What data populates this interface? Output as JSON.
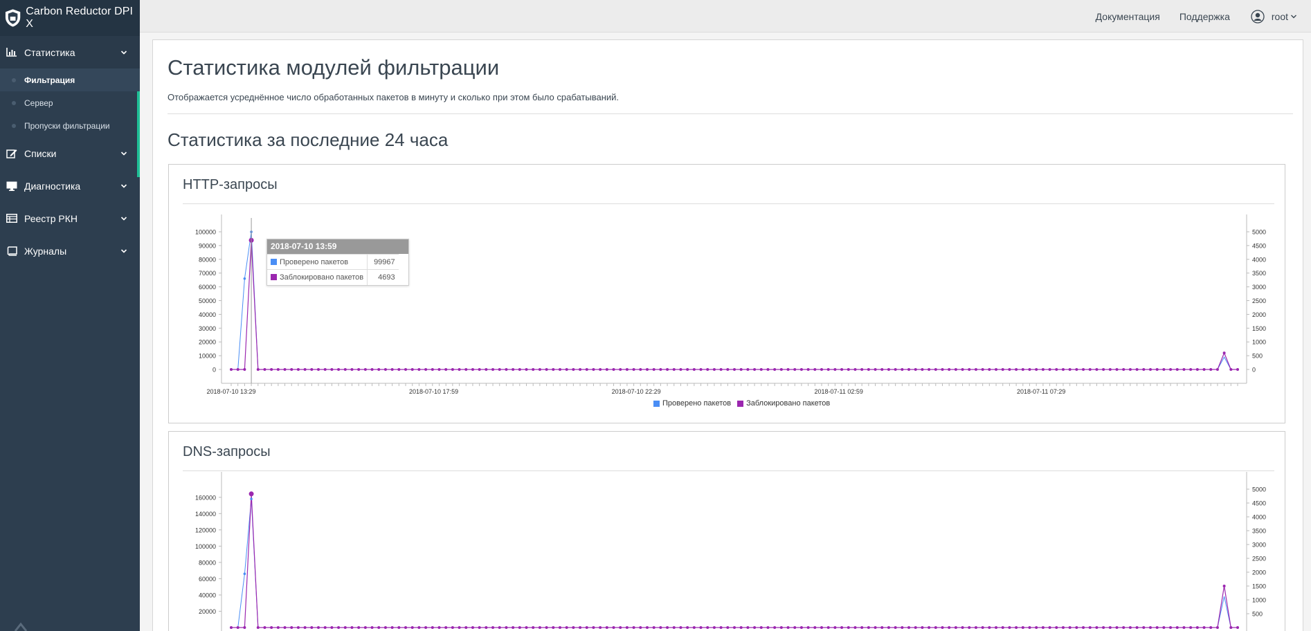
{
  "brand": {
    "title": "Carbon Reductor DPI X"
  },
  "sidebar": {
    "items": [
      {
        "label": "Статистика",
        "icon": "bar-chart-icon"
      },
      {
        "label": "Списки",
        "icon": "edit-icon"
      },
      {
        "label": "Диагностика",
        "icon": "monitor-icon"
      },
      {
        "label": "Реестр РКН",
        "icon": "table-icon"
      },
      {
        "label": "Журналы",
        "icon": "book-icon"
      }
    ],
    "subitems": [
      {
        "label": "Фильтрация",
        "active": true
      },
      {
        "label": "Сервер"
      },
      {
        "label": "Пропуски фильтрации"
      }
    ]
  },
  "topbar": {
    "docs": "Документация",
    "support": "Поддержка",
    "user": "root"
  },
  "page": {
    "title": "Статистика модулей фильтрации",
    "description": "Отображается усреднённое число обработанных пакетов в минуту и сколько при этом было срабатываний.",
    "section": "Статистика за последние 24 часа"
  },
  "colors": {
    "checked": "#4a8ef5",
    "blocked": "#9b27af",
    "accent": "#1fbf96",
    "sidebar": "#2d3e4f"
  },
  "http_panel": {
    "title": "HTTP-запросы",
    "tooltip": {
      "time": "2018-07-10 13:59",
      "rows": [
        {
          "label": "Проверено пакетов",
          "value": "99967"
        },
        {
          "label": "Заблокировано пакетов",
          "value": "4693"
        }
      ]
    },
    "legend": [
      "Проверено пакетов",
      "Заблокировано пакетов"
    ]
  },
  "dns_panel": {
    "title": "DNS-запросы"
  },
  "chart_data": [
    {
      "type": "line",
      "title": "HTTP-запросы",
      "x_ticks": [
        "2018-07-10 13:29",
        "2018-07-10 17:59",
        "2018-07-10 22:29",
        "2018-07-11 02:59",
        "2018-07-11 07:29"
      ],
      "y_left_ticks": [
        0,
        10000,
        20000,
        30000,
        40000,
        50000,
        60000,
        70000,
        80000,
        90000,
        100000
      ],
      "y_right_ticks": [
        0,
        500,
        1000,
        1500,
        2000,
        2500,
        3000,
        3500,
        4000,
        4500,
        5000
      ],
      "ylim_left": [
        0,
        100000
      ],
      "ylim_right": [
        0,
        5000
      ],
      "series": [
        {
          "name": "Проверено пакетов",
          "axis": "left",
          "values": [
            0,
            0,
            66000,
            99967,
            0
          ]
        },
        {
          "name": "Заблокировано пакетов",
          "axis": "right",
          "values": [
            0,
            0,
            0,
            4693,
            0
          ]
        }
      ],
      "tail_peak_right": 600,
      "legend": "bottom-center"
    },
    {
      "type": "line",
      "title": "DNS-запросы",
      "y_left_ticks": [
        20000,
        40000,
        60000,
        80000,
        100000,
        120000,
        140000,
        160000
      ],
      "y_right_ticks": [
        500,
        1000,
        1500,
        2000,
        2500,
        3000,
        3500,
        4000,
        4500,
        5000
      ],
      "ylim_left": [
        0,
        170000
      ],
      "ylim_right": [
        0,
        5000
      ],
      "series": [
        {
          "name": "Проверено пакетов",
          "axis": "left",
          "values": [
            0,
            0,
            66000,
            158000,
            0
          ]
        },
        {
          "name": "Заблокировано пакетов",
          "axis": "right",
          "values": [
            0,
            0,
            0,
            4830,
            0
          ]
        }
      ],
      "tail_peak_right": 1500,
      "legend": "bottom-center"
    }
  ]
}
